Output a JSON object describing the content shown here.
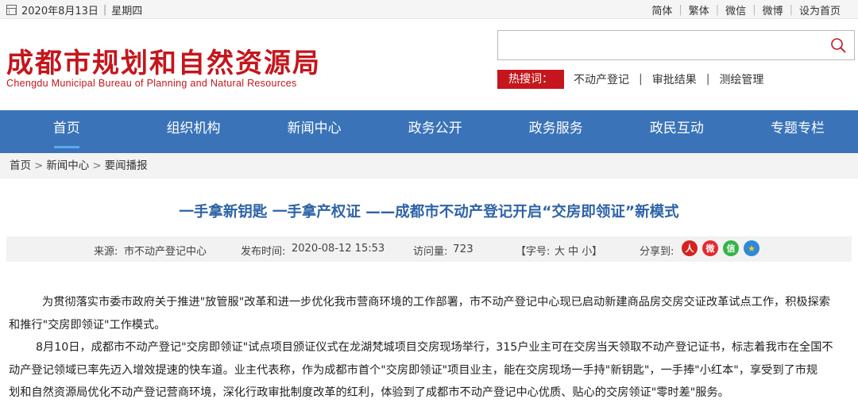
{
  "topbar": {
    "date": "2020年8月13日",
    "sep": "|",
    "weekday": "星期四",
    "links": [
      "简体",
      "繁体",
      "微信",
      "微博",
      "设为首页"
    ]
  },
  "header": {
    "logo_cn": "成都市规划和自然资源局",
    "logo_en": "Chengdu Municipal Bureau of Planning and Natural Resources",
    "search": {
      "value": "",
      "placeholder": ""
    },
    "hot_label": "热搜词：",
    "hot_items": [
      "不动产登记",
      "审批结果",
      "测绘管理"
    ]
  },
  "nav": [
    "首页",
    "组织机构",
    "新闻中心",
    "政务公开",
    "政务服务",
    "政民互动",
    "专题专栏"
  ],
  "breadcrumb": [
    "首页",
    "新闻中心",
    "要闻播报"
  ],
  "article": {
    "title": "一手拿新钥匙 一手拿产权证 ——成都市不动产登记开启“交房即领证”新模式",
    "source_label": "来源:",
    "source": "市不动产登记中心",
    "time_label": "发布时间:",
    "time": "2020-08-12 15:53",
    "visits_label": "访问量:",
    "visits": "723",
    "font_label": "【字号:",
    "font_sizes": "大 中 小",
    "font_close": "】",
    "share_label": "分享到:",
    "p1_line1": "为贯彻落实市委市政府关于推进\"放管服\"改革和进一步优化我市营商环境的工作部署，市不动产登记中心现已启动新建商品房交房交证改革试点工作，积极探索",
    "p1_line2": "和推行\"交房即领证\"工作模式。",
    "p2_line1": "8月10日，成都市不动产登记\"交房即领证\"试点项目颁证仪式在龙湖梵城项目交房现场举行，315户业主可在交房当天领取不动产登记证书，标志着我市在全国不",
    "p2_line2": "动产登记领域已率先迈入增效提速的快车道。业主代表称，作为成都市首个\"交房即领证\"项目业主，能在交房现场一手持\"新钥匙\"，一手捧\"小红本\"，享受到了市规",
    "p2_line3": "划和自然资源局优化不动产登记营商环境，深化行政审批制度改革的红利，体验到了成都市不动产登记中心优质、贴心的交房领证\"零时差\"服务。"
  },
  "colors": {
    "brand_red": "#c4161c",
    "nav_blue": "#3a73b8",
    "title_blue": "#2e63a7"
  }
}
